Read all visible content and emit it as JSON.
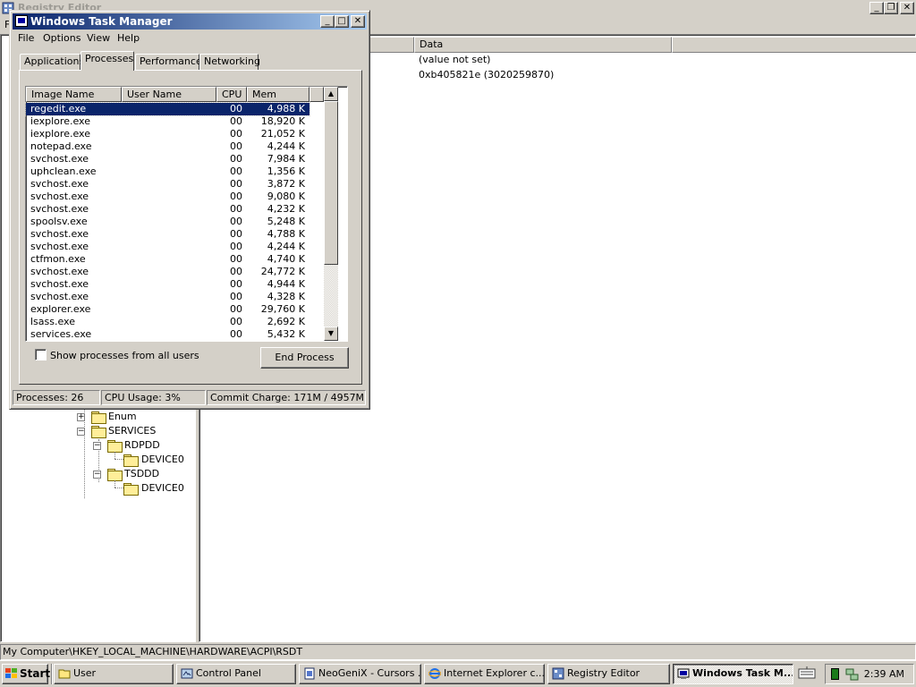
{
  "regedit": {
    "title": "Registry Editor",
    "menu_first": "F",
    "columns": {
      "data": "Data"
    },
    "values": [
      {
        "data": "(value not set)"
      },
      {
        "data": "0xb405821e (3020259870)"
      }
    ],
    "tree": [
      {
        "label": "Enum",
        "expander": "+"
      },
      {
        "label": "SERVICES",
        "expander": "−"
      },
      {
        "label": "RDPDD",
        "expander": "−"
      },
      {
        "label": "DEVICE0"
      },
      {
        "label": "TSDDD",
        "expander": "−"
      },
      {
        "label": "DEVICE0"
      }
    ],
    "status": "My Computer\\HKEY_LOCAL_MACHINE\\HARDWARE\\ACPI\\RSDT"
  },
  "taskmgr": {
    "title": "Windows Task Manager",
    "menu": [
      "File",
      "Options",
      "View",
      "Help"
    ],
    "tabs": [
      "Applications",
      "Processes",
      "Performance",
      "Networking"
    ],
    "active_tab": "Processes",
    "columns": [
      "Image Name",
      "User Name",
      "CPU",
      "Mem Usage"
    ],
    "processes": [
      {
        "name": "regedit.exe",
        "user": "",
        "cpu": "00",
        "mem": "4,988 K",
        "selected": true
      },
      {
        "name": "iexplore.exe",
        "user": "",
        "cpu": "00",
        "mem": "18,920 K"
      },
      {
        "name": "iexplore.exe",
        "user": "",
        "cpu": "00",
        "mem": "21,052 K"
      },
      {
        "name": "notepad.exe",
        "user": "",
        "cpu": "00",
        "mem": "4,244 K"
      },
      {
        "name": "svchost.exe",
        "user": "",
        "cpu": "00",
        "mem": "7,984 K"
      },
      {
        "name": "uphclean.exe",
        "user": "",
        "cpu": "00",
        "mem": "1,356 K"
      },
      {
        "name": "svchost.exe",
        "user": "",
        "cpu": "00",
        "mem": "3,872 K"
      },
      {
        "name": "svchost.exe",
        "user": "",
        "cpu": "00",
        "mem": "9,080 K"
      },
      {
        "name": "svchost.exe",
        "user": "",
        "cpu": "00",
        "mem": "4,232 K"
      },
      {
        "name": "spoolsv.exe",
        "user": "",
        "cpu": "00",
        "mem": "5,248 K"
      },
      {
        "name": "svchost.exe",
        "user": "",
        "cpu": "00",
        "mem": "4,788 K"
      },
      {
        "name": "svchost.exe",
        "user": "",
        "cpu": "00",
        "mem": "4,244 K"
      },
      {
        "name": "ctfmon.exe",
        "user": "",
        "cpu": "00",
        "mem": "4,740 K"
      },
      {
        "name": "svchost.exe",
        "user": "",
        "cpu": "00",
        "mem": "24,772 K"
      },
      {
        "name": "svchost.exe",
        "user": "",
        "cpu": "00",
        "mem": "4,944 K"
      },
      {
        "name": "svchost.exe",
        "user": "",
        "cpu": "00",
        "mem": "4,328 K"
      },
      {
        "name": "explorer.exe",
        "user": "",
        "cpu": "00",
        "mem": "29,760 K"
      },
      {
        "name": "lsass.exe",
        "user": "",
        "cpu": "00",
        "mem": "2,692 K"
      },
      {
        "name": "services.exe",
        "user": "",
        "cpu": "00",
        "mem": "5,432 K"
      }
    ],
    "show_all_label": "Show processes from all users",
    "show_all_checked": false,
    "end_process_label": "End Process",
    "status": {
      "processes": "Processes: 26",
      "cpu": "CPU Usage: 3%",
      "commit": "Commit Charge: 171M / 4957M"
    }
  },
  "taskbar": {
    "start_label": "Start",
    "buttons": [
      {
        "label": "User",
        "icon": "folder-icon"
      },
      {
        "label": "Control Panel",
        "icon": "control-panel-icon"
      },
      {
        "label": "NeoGeniX - Cursors ...",
        "icon": "document-icon"
      },
      {
        "label": "Internet Explorer c...",
        "icon": "internet-explorer-icon"
      },
      {
        "label": "Registry Editor",
        "icon": "registry-editor-icon"
      },
      {
        "label": "Windows Task M...",
        "icon": "task-manager-icon",
        "active": true
      }
    ],
    "clock": "2:39 AM"
  },
  "colors": {
    "face": "#d4d0c8",
    "title_active_start": "#0a246a",
    "title_active_end": "#a6caf0",
    "selection": "#0a246a"
  }
}
